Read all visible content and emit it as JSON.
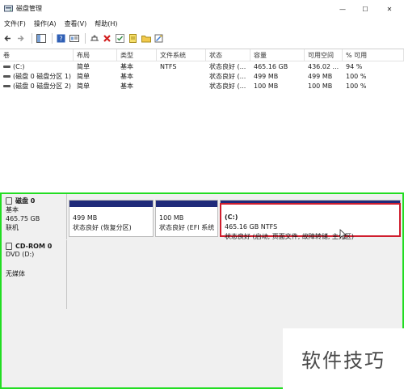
{
  "window": {
    "title": "磁盘管理",
    "controls": {
      "minimize": "—",
      "maximize": "☐",
      "close": "✕"
    }
  },
  "menu": [
    "文件(F)",
    "操作(A)",
    "查看(V)",
    "帮助(H)"
  ],
  "toolbar": {
    "icons": [
      "back-icon",
      "forward-icon",
      "show-hide-tree-icon",
      "help-icon",
      "properties-icon",
      "connect-icon",
      "delete-icon",
      "checkmark-icon",
      "new-icon",
      "folder-icon",
      "wizard-icon"
    ]
  },
  "volumes": {
    "columns": [
      "卷",
      "布局",
      "类型",
      "文件系统",
      "状态",
      "容量",
      "可用空间",
      "% 可用"
    ],
    "rows": [
      [
        "(C:)",
        "简单",
        "基本",
        "NTFS",
        "状态良好 (...",
        "465.16 GB",
        "436.02 ...",
        "94 %"
      ],
      [
        "(磁盘 0 磁盘分区 1)",
        "简单",
        "基本",
        "",
        "状态良好 (...",
        "499 MB",
        "499 MB",
        "100 %"
      ],
      [
        "(磁盘 0 磁盘分区 2)",
        "简单",
        "基本",
        "",
        "状态良好 (...",
        "100 MB",
        "100 MB",
        "100 %"
      ]
    ]
  },
  "disks": [
    {
      "name": "磁盘 0",
      "type": "基本",
      "size": "465.75 GB",
      "status": "联机",
      "partitions": [
        {
          "title": "",
          "size": "499 MB",
          "status": "状态良好 (恢复分区)"
        },
        {
          "title": "",
          "size": "100 MB",
          "status": "状态良好 (EFI 系统"
        },
        {
          "title": "(C:)",
          "size": "465.16 GB NTFS",
          "status": "状态良好 (启动, 页面文件, 故障转储, 主分区)"
        }
      ]
    },
    {
      "name": "CD-ROM 0",
      "type": "DVD (D:)",
      "size": "",
      "status": "无媒体"
    }
  ],
  "watermark": "软件技巧",
  "colors": {
    "partition_bar": "#1f2a7a",
    "selection": "#d01e2e",
    "highlight_frame": "#22dd22"
  }
}
